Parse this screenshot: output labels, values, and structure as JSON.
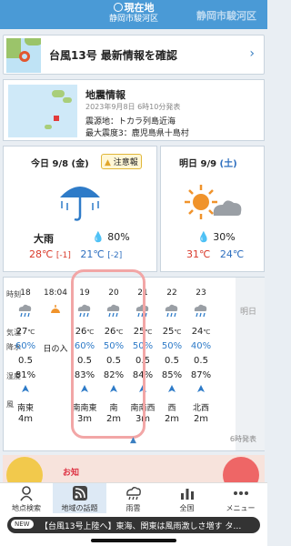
{
  "header": {
    "now_label": "現在地",
    "city": "静岡市駿河区",
    "right_city": "静岡市駿河区"
  },
  "typhoon_banner": {
    "title": "台風13号 最新情報を確認"
  },
  "earthquake": {
    "title": "地震情報",
    "datetime": "2023年9月8日 6時10分発表",
    "epicenter": "震源地：トカラ列島近海",
    "max_intensity": "最大震度3：鹿児島県十島村"
  },
  "today": {
    "header": "今日 9/8 (金)",
    "warning_badge": "注意報",
    "condition": "大雨",
    "pop": "80%",
    "high": "28",
    "high_diff": "[-1]",
    "low": "21",
    "low_diff": "[-2]",
    "unit": "℃"
  },
  "tomorrow": {
    "header": "明日 9/9",
    "weekday": "(土)",
    "pop": "30%",
    "high": "31",
    "low": "24",
    "unit": "℃"
  },
  "hourly": {
    "row_labels": [
      "時刻",
      "気温",
      "降水",
      "湿度",
      "風"
    ],
    "next_day_label": "明日",
    "update_note": "6時発表",
    "sunset_label": "日の入",
    "columns": [
      {
        "time": "18",
        "temp": "27",
        "rain_pct": "60%",
        "rain_mm": "0.5",
        "humidity": "81%",
        "wind_dir": "南東",
        "wind_speed": "4m"
      },
      {
        "time": "18:04",
        "temp": "",
        "rain_pct": "",
        "rain_mm": "",
        "humidity": "",
        "wind_dir": "",
        "wind_speed": ""
      },
      {
        "time": "19",
        "temp": "26",
        "rain_pct": "60%",
        "rain_mm": "0.5",
        "humidity": "83%",
        "wind_dir": "南南東",
        "wind_speed": "3m"
      },
      {
        "time": "20",
        "temp": "26",
        "rain_pct": "50%",
        "rain_mm": "0.5",
        "humidity": "82%",
        "wind_dir": "南",
        "wind_speed": "2m"
      },
      {
        "time": "21",
        "temp": "25",
        "rain_pct": "50%",
        "rain_mm": "0.5",
        "humidity": "84%",
        "wind_dir": "南南西",
        "wind_speed": "3m"
      },
      {
        "time": "22",
        "temp": "25",
        "rain_pct": "50%",
        "rain_mm": "0.5",
        "humidity": "85%",
        "wind_dir": "西",
        "wind_speed": "2m"
      },
      {
        "time": "23",
        "temp": "24",
        "rain_pct": "40%",
        "rain_mm": "0.5",
        "humidity": "87%",
        "wind_dir": "北西",
        "wind_speed": "2m"
      }
    ]
  },
  "ad": {
    "text": "お知"
  },
  "tabs": [
    {
      "label": "地点検索",
      "icon": "search-icon"
    },
    {
      "label": "地域の話題",
      "icon": "rss-icon"
    },
    {
      "label": "雨雲",
      "icon": "rain-cloud-icon"
    },
    {
      "label": "全国",
      "icon": "bar-chart-icon"
    },
    {
      "label": "メニュー",
      "icon": "more-icon"
    }
  ],
  "ticker": {
    "badge": "NEW",
    "text": "【台風13号上陸へ】東海、関東は風雨激しさ増す タ…"
  },
  "colors": {
    "header_blue": "#4a9ad6",
    "high_red": "#d93a2b",
    "low_blue": "#2e6fbf",
    "rain_blue": "#2e7bc8"
  }
}
